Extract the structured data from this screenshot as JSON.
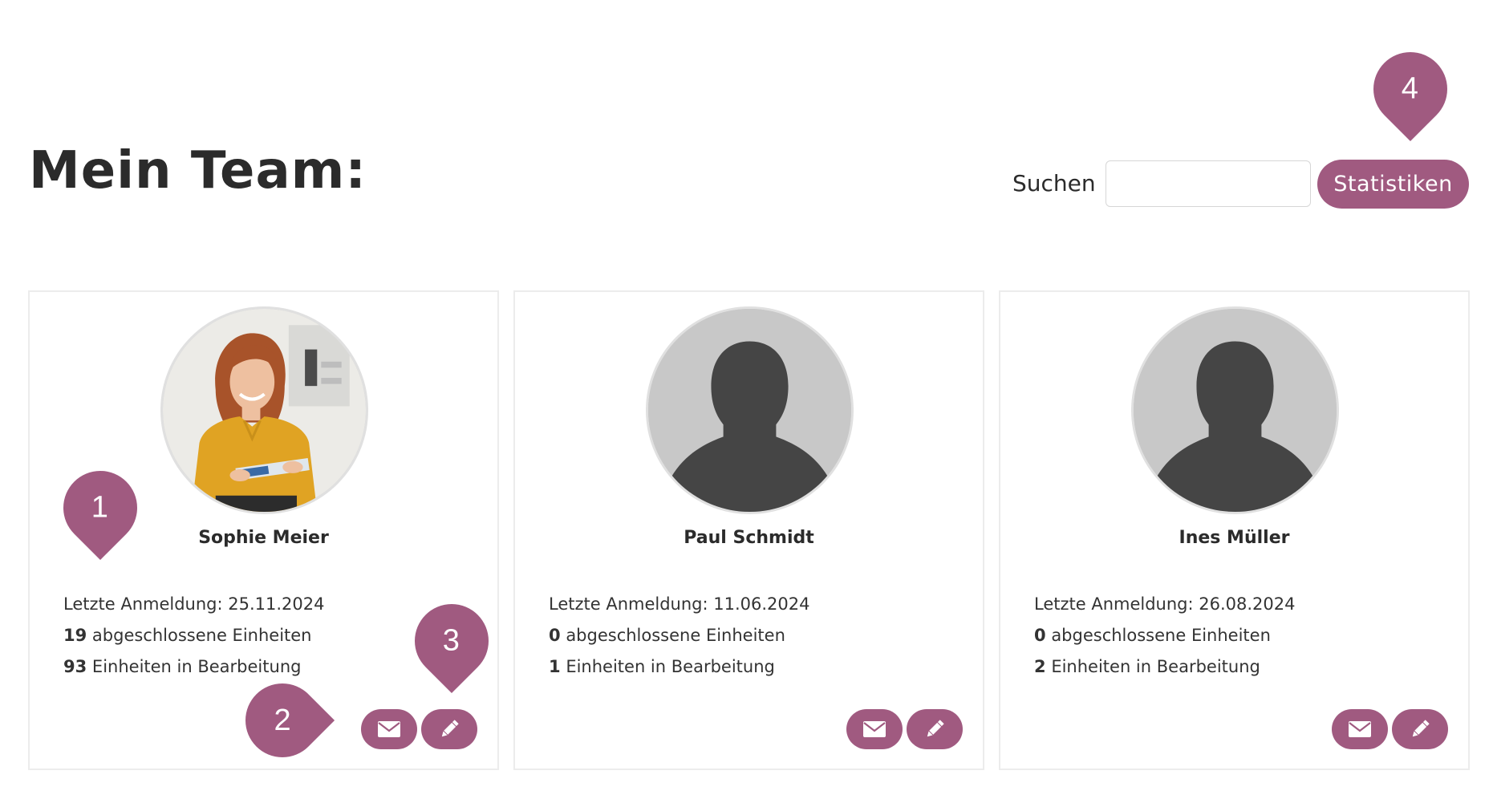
{
  "header": {
    "title": "Mein Team:",
    "search_label": "Suchen",
    "search_value": "",
    "stats_button": "Statistiken"
  },
  "accent_color": "#a05a80",
  "members": [
    {
      "name": "Sophie Meier",
      "avatar": "photo",
      "last_login_label": "Letzte Anmeldung: 25.11.2024",
      "completed_count": "19",
      "completed_label": "abgeschlossene Einheiten",
      "in_progress_count": "93",
      "in_progress_label": "Einheiten in Bearbeitung"
    },
    {
      "name": "Paul Schmidt",
      "avatar": "placeholder-silhouette",
      "last_login_label": "Letzte Anmeldung: 11.06.2024",
      "completed_count": "0",
      "completed_label": "abgeschlossene Einheiten",
      "in_progress_count": "1",
      "in_progress_label": "Einheiten in Bearbeitung"
    },
    {
      "name": "Ines Müller",
      "avatar": "placeholder-silhouette",
      "last_login_label": "Letzte Anmeldung: 26.08.2024",
      "completed_count": "0",
      "completed_label": "abgeschlossene Einheiten",
      "in_progress_count": "2",
      "in_progress_label": "Einheiten in Bearbeitung"
    }
  ],
  "card_actions": {
    "mail_icon": "envelope-icon",
    "edit_icon": "pencil-icon"
  },
  "annotations": [
    "1",
    "2",
    "3",
    "4"
  ]
}
